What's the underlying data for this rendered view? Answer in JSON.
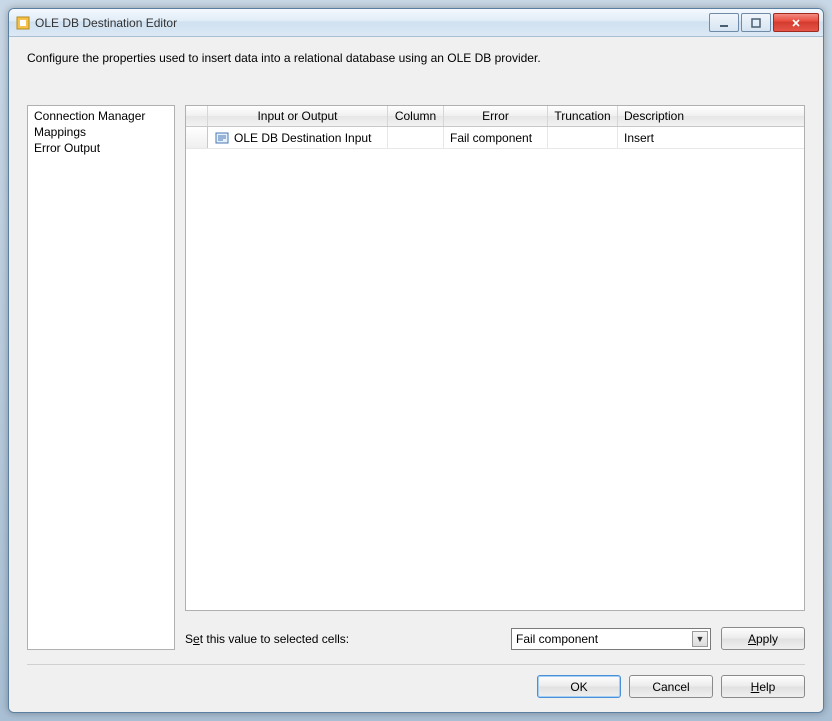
{
  "titlebar": {
    "title": "OLE DB Destination Editor"
  },
  "description": "Configure the properties used to insert data into a relational database using an OLE DB provider.",
  "sidebar": {
    "items": [
      {
        "label": "Connection Manager"
      },
      {
        "label": "Mappings"
      },
      {
        "label": "Error Output"
      }
    ]
  },
  "grid": {
    "headers": {
      "io": "Input or Output",
      "column": "Column",
      "error": "Error",
      "truncation": "Truncation",
      "description": "Description"
    },
    "rows": [
      {
        "io": "OLE DB Destination Input",
        "column": "",
        "error": "Fail component",
        "truncation": "",
        "description": "Insert"
      }
    ]
  },
  "setValue": {
    "label_prefix": "S",
    "label_ul": "e",
    "label_rest": "t this value to selected cells:",
    "selected": "Fail component",
    "apply_ul": "A",
    "apply_rest": "pply"
  },
  "footer": {
    "ok": "OK",
    "cancel": "Cancel",
    "help_ul": "H",
    "help_rest": "elp"
  }
}
